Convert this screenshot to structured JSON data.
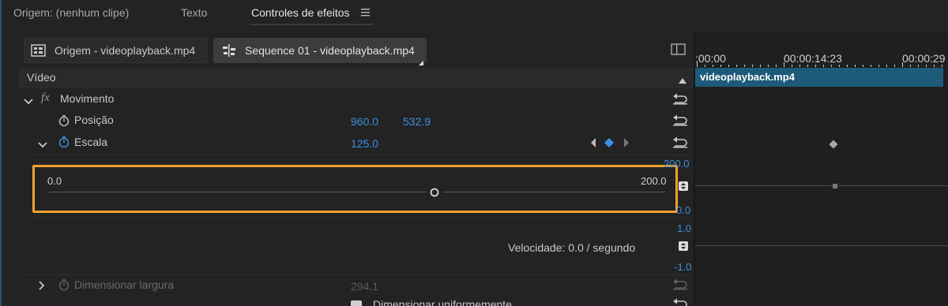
{
  "tabs": [
    {
      "label": "Origem: (nenhum clipe)"
    },
    {
      "label": "Texto"
    },
    {
      "label": "Controles de efeitos"
    }
  ],
  "clip_tabs": {
    "source": "Origem - videoplayback.mp4",
    "sequence": "Sequence 01 - videoplayback.mp4"
  },
  "timeline": {
    "tc_start": ":00:00",
    "tc_mid": "00:00:14:23",
    "tc_end": "00:00:29",
    "clip_name": "videoplayback.mp4",
    "graph_top": "200.0",
    "graph_bottom": "0.0",
    "vel_top": "1.0",
    "vel_bottom": "-1.0"
  },
  "section": {
    "video_label": "Vídeo"
  },
  "effects": {
    "movimento": {
      "name": "Movimento"
    },
    "posicao": {
      "name": "Posição",
      "x": "960.0",
      "y": "532.9"
    },
    "escala": {
      "name": "Escala",
      "value": "125.0"
    },
    "slider": {
      "min": "0.0",
      "max": "200.0",
      "value_fraction": 0.625
    },
    "velocidade": "Velocidade: 0.0 / segundo",
    "dimensionar": {
      "name": "Dimensionar largura",
      "value": "294.1"
    },
    "uniforme": {
      "name": "Dimensionar uniformemente"
    }
  },
  "colors": {
    "accent_blue": "#3a8fe0",
    "highlight": "#f0a030",
    "clip_bar": "#1d5a7a"
  }
}
